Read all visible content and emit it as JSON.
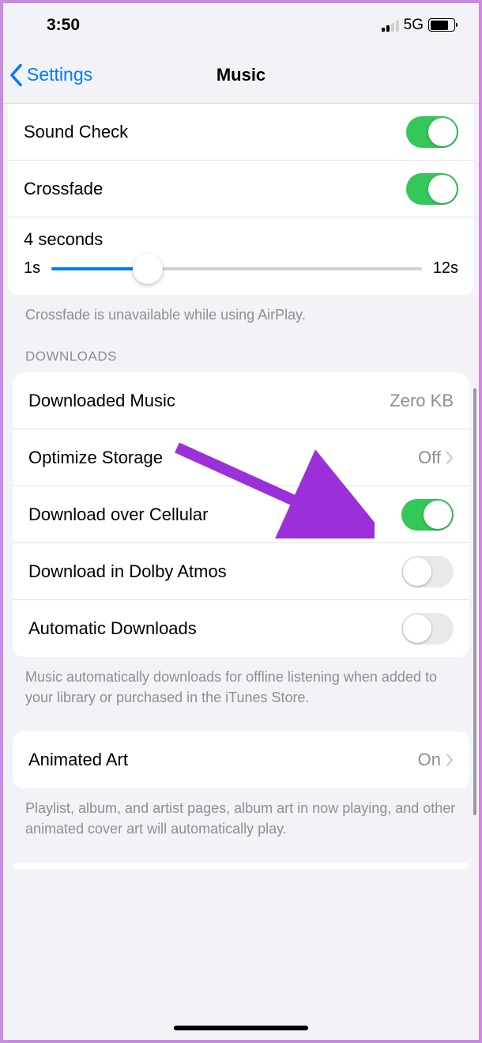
{
  "status": {
    "time": "3:50",
    "data_type": "5G"
  },
  "nav": {
    "back_label": "Settings",
    "title": "Music"
  },
  "playback_group": {
    "sound_check": {
      "label": "Sound Check",
      "on": true
    },
    "crossfade": {
      "label": "Crossfade",
      "on": true
    },
    "slider": {
      "value_label": "4 seconds",
      "min_label": "1s",
      "max_label": "12s"
    },
    "footer": "Crossfade is unavailable while using AirPlay."
  },
  "downloads": {
    "header": "Downloads",
    "downloaded_music": {
      "label": "Downloaded Music",
      "value": "Zero KB"
    },
    "optimize_storage": {
      "label": "Optimize Storage",
      "value": "Off"
    },
    "download_cellular": {
      "label": "Download over Cellular",
      "on": true
    },
    "download_dolby": {
      "label": "Download in Dolby Atmos",
      "on": false
    },
    "auto_downloads": {
      "label": "Automatic Downloads",
      "on": false
    },
    "footer": "Music automatically downloads for offline listening when added to your library or purchased in the iTunes Store."
  },
  "animated_art": {
    "label": "Animated Art",
    "value": "On",
    "footer": "Playlist, album, and artist pages, album art in now playing, and other animated cover art will automatically play."
  }
}
